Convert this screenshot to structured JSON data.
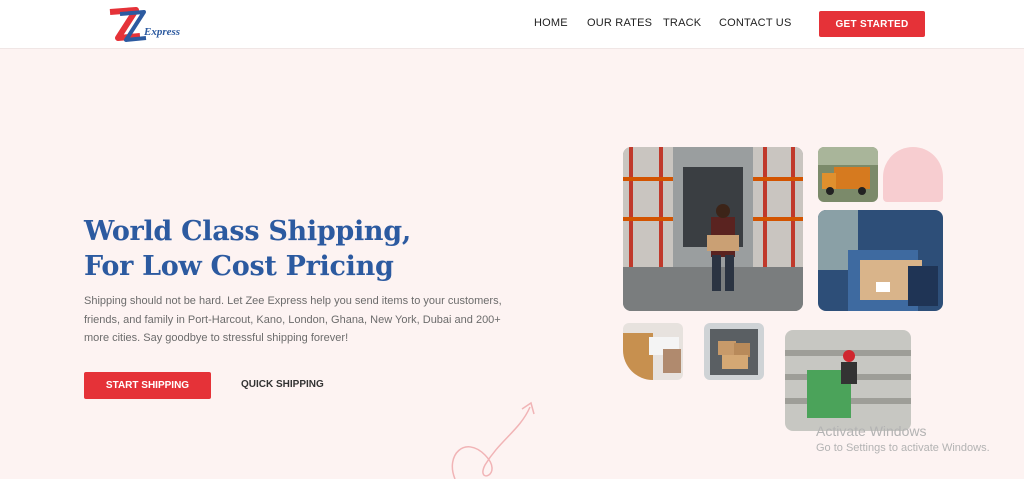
{
  "brand": {
    "logo_letter": "Z",
    "name": "Express"
  },
  "nav": {
    "home": "HOME",
    "rates": "OUR RATES",
    "track": "TRACK",
    "contact": "CONTACT US",
    "cta": "GET STARTED"
  },
  "hero": {
    "title_line1": "World Class Shipping,",
    "title_line2": "For Low Cost Pricing",
    "subtitle": "Shipping should not be hard. Let Zee Express help you send items to your customers, friends, and family in Port-Harcout, Kano, London, Ghana, New York, Dubai and 200+ more cities. Say goodbye to stressful shipping forever!",
    "primary_button": "START SHIPPING",
    "secondary_button": "QUICK SHIPPING"
  },
  "watermark": {
    "line1": "Activate Windows",
    "line2": "Go to Settings to activate Windows."
  },
  "colors": {
    "accent": "#e53238",
    "brand_blue": "#2c5aa0",
    "background": "#fdf3f2"
  }
}
